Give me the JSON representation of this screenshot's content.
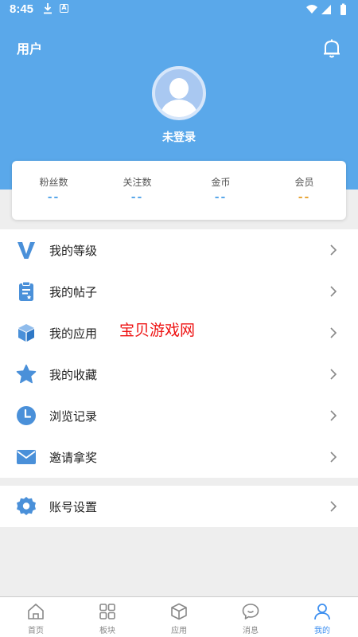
{
  "status_bar": {
    "time": "8:45",
    "badge": "A"
  },
  "header": {
    "title": "用户",
    "login_text": "未登录"
  },
  "stats": [
    {
      "label": "粉丝数",
      "value": "--",
      "color": "#5aa8ea"
    },
    {
      "label": "关注数",
      "value": "--",
      "color": "#5aa8ea"
    },
    {
      "label": "金币",
      "value": "--",
      "color": "#5aa8ea"
    },
    {
      "label": "会员",
      "value": "--",
      "color": "#e8a63a"
    }
  ],
  "menu": [
    {
      "label": "我的等级",
      "icon": "vip-level-icon"
    },
    {
      "label": "我的帖子",
      "icon": "clipboard-icon"
    },
    {
      "label": "我的应用",
      "icon": "cube-icon"
    },
    {
      "label": "我的收藏",
      "icon": "star-icon"
    },
    {
      "label": "浏览记录",
      "icon": "clock-icon"
    },
    {
      "label": "邀请拿奖",
      "icon": "mail-icon"
    }
  ],
  "settings": {
    "label": "账号设置",
    "icon": "gear-icon"
  },
  "watermark": "宝贝游戏网",
  "bottom_nav": [
    {
      "label": "首页",
      "icon": "home-icon"
    },
    {
      "label": "板块",
      "icon": "grid-icon"
    },
    {
      "label": "应用",
      "icon": "box-icon"
    },
    {
      "label": "消息",
      "icon": "chat-icon"
    },
    {
      "label": "我的",
      "icon": "user-icon",
      "active": true
    }
  ],
  "colors": {
    "accent": "#5aa8ea",
    "active_tab": "#3d8ff0",
    "member": "#e8a63a"
  }
}
